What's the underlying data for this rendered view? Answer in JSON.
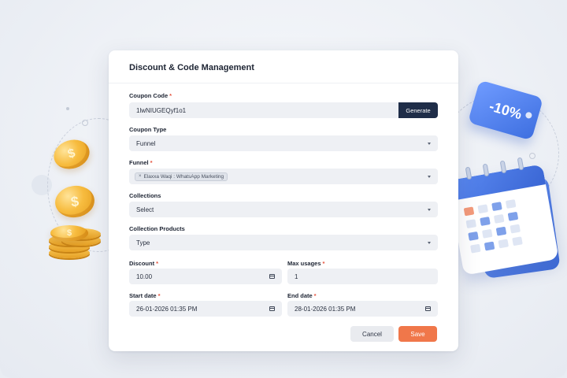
{
  "modal": {
    "title": "Discount & Code Management"
  },
  "fields": {
    "coupon_code": {
      "label": "Coupon Code",
      "required": "*",
      "value": "1lwNIUGEQyf1o1",
      "button": "Generate"
    },
    "coupon_type": {
      "label": "Coupon Type",
      "value": "Funnel"
    },
    "funnel": {
      "label": "Funnel",
      "required": "*",
      "chip": "Elaxxa Waqi : WhatsApp Marketing",
      "chip_remove": "×"
    },
    "collections": {
      "label": "Collections",
      "placeholder": "Select"
    },
    "collection_products": {
      "label": "Collection Products",
      "placeholder": "Type"
    },
    "discount": {
      "label": "Discount",
      "required": "*",
      "value": "10.00"
    },
    "max_usages": {
      "label": "Max usages",
      "required": "*",
      "value": "1"
    },
    "start_date": {
      "label": "Start date",
      "required": "*",
      "value": "26-01-2026 01:35 PM"
    },
    "end_date": {
      "label": "End date",
      "required": "*",
      "value": "28-01-2026 01:35 PM"
    }
  },
  "actions": {
    "cancel": "Cancel",
    "save": "Save"
  },
  "decor": {
    "tag_text": "-10%",
    "coin_symbol": "$",
    "colors": {
      "primary_button": "#1f2d48",
      "save_button": "#f0774a",
      "required_marker": "#e5533d",
      "tag_blue": "#3e6fe0",
      "coin_gold": "#f7bc3f"
    },
    "icons": [
      "coin-icon",
      "discount-tag-icon",
      "calendar-illustration",
      "chevron-down-icon",
      "calendar-icon"
    ]
  }
}
